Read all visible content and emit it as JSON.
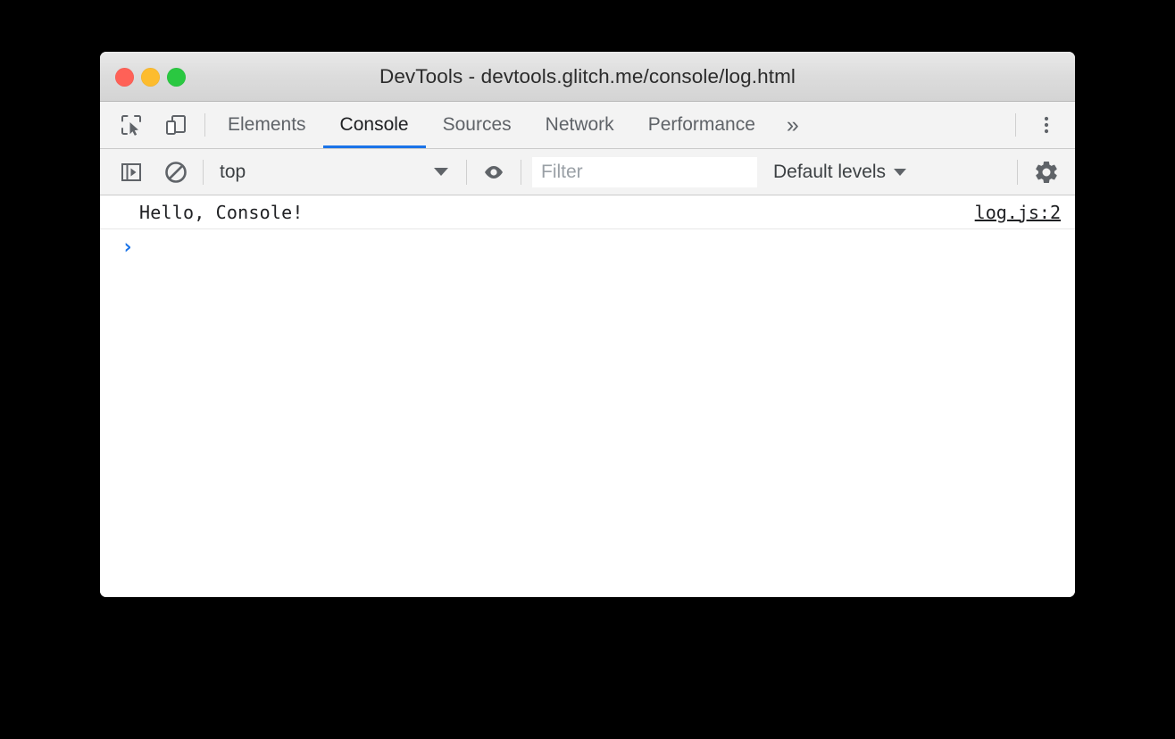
{
  "window": {
    "title": "DevTools - devtools.glitch.me/console/log.html",
    "traffic_lights": {
      "close": "close-button",
      "minimize": "minimize-button",
      "maximize": "maximize-button",
      "close_color": "#ff6157",
      "minimize_color": "#fdbc2e",
      "maximize_color": "#2ac841"
    }
  },
  "tab_bar": {
    "inspect_icon": "inspect-element-icon",
    "device_icon": "device-toolbar-icon",
    "tabs": [
      {
        "label": "Elements",
        "active": false
      },
      {
        "label": "Console",
        "active": true
      },
      {
        "label": "Sources",
        "active": false
      },
      {
        "label": "Network",
        "active": false
      },
      {
        "label": "Performance",
        "active": false
      }
    ],
    "more_tabs_label": "»",
    "main_menu_icon": "kebab-menu-icon",
    "active_tab_underline_color": "#1a73e8"
  },
  "console_toolbar": {
    "sidebar_toggle_icon": "console-sidebar-toggle-icon",
    "clear_console_icon": "clear-console-icon",
    "context_value": "top",
    "context_options": [
      "top"
    ],
    "live_expression_icon": "eye-icon",
    "filter_value": "",
    "filter_placeholder": "Filter",
    "levels_label": "Default levels",
    "levels_options": [
      "Default levels"
    ],
    "settings_icon": "settings-gear-icon"
  },
  "console": {
    "messages": [
      {
        "text": "Hello, Console!",
        "source": "log.js:2"
      }
    ],
    "prompt_symbol": "›",
    "prompt_value": ""
  }
}
